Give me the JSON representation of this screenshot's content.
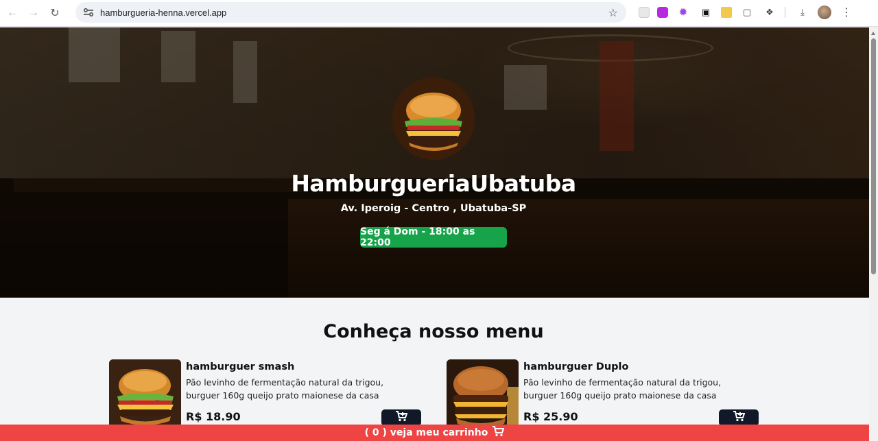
{
  "browser": {
    "url": "hamburgueria-henna.vercel.app"
  },
  "hero": {
    "title": "HamburgueriaUbatuba",
    "address": "Av. Iperoig - Centro , Ubatuba-SP",
    "hours": "Seg á Dom - 18:00 as 22:00",
    "hours_color": "#16a34a"
  },
  "menu": {
    "heading": "Conheça nosso menu",
    "items": [
      {
        "name": "hamburguer smash",
        "description": "Pão levinho de fermentação natural da trigou, burguer 160g queijo prato maionese da casa",
        "price": "R$ 18.90",
        "icon": "cart-plus-icon"
      },
      {
        "name": "hamburguer Duplo",
        "description": "Pão levinho de fermentação natural da trigou, burguer 160g queijo prato maionese da casa",
        "price": "R$ 25.90",
        "icon": "cart-plus-icon"
      }
    ]
  },
  "cart_bar": {
    "label": "( 0 ) veja meu carrinho",
    "color": "#ef4444",
    "icon": "cart-icon"
  }
}
